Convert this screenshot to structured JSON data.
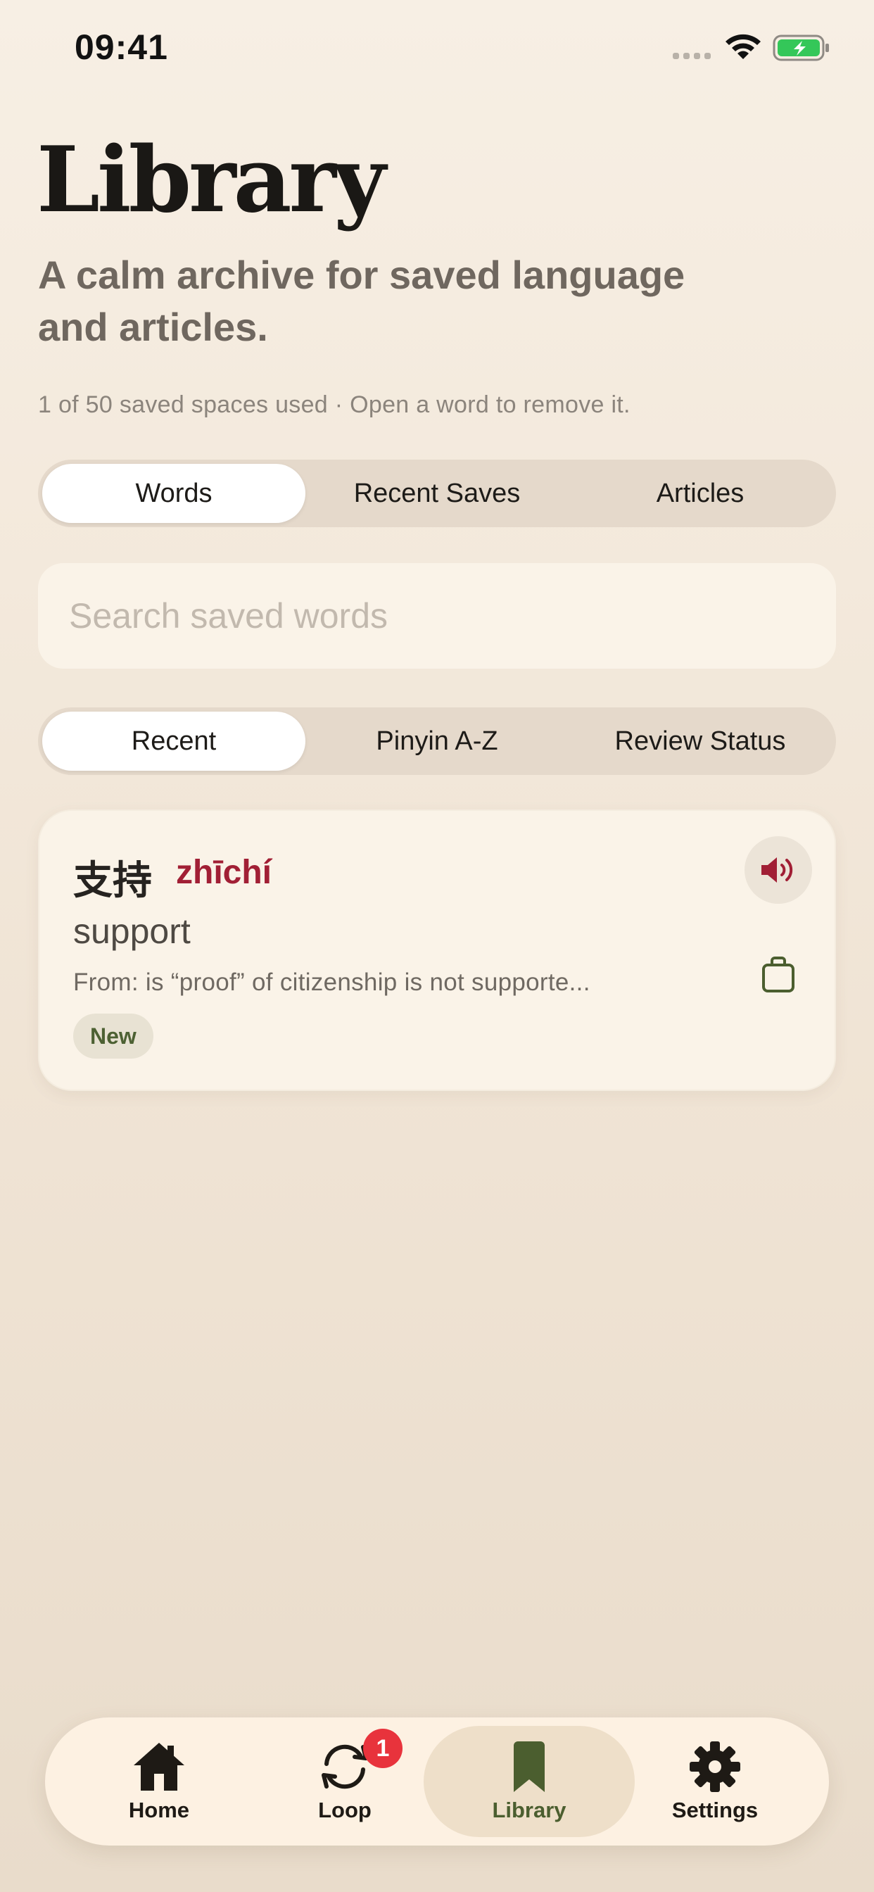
{
  "status_bar": {
    "time": "09:41"
  },
  "header": {
    "title": "Library",
    "subtitle": "A calm archive for saved language and articles.",
    "usage_note": "1 of 50 saved spaces used · Open a word to remove it."
  },
  "library_tabs": [
    {
      "label": "Words",
      "active": true
    },
    {
      "label": "Recent Saves",
      "active": false
    },
    {
      "label": "Articles",
      "active": false
    }
  ],
  "search": {
    "placeholder": "Search saved words"
  },
  "sort_options": [
    {
      "label": "Recent",
      "active": true
    },
    {
      "label": "Pinyin A-Z",
      "active": false
    },
    {
      "label": "Review Status",
      "active": false
    }
  ],
  "words": [
    {
      "hanzi": "支持",
      "pinyin": "zhīchí",
      "meaning": "support",
      "source": "From: is “proof” of citizenship is not supporte...",
      "badge": "New"
    }
  ],
  "tab_bar": {
    "items": [
      {
        "label": "Home",
        "icon": "house-icon",
        "active": false
      },
      {
        "label": "Loop",
        "icon": "loop-arrows-icon",
        "active": false,
        "badge": "1"
      },
      {
        "label": "Library",
        "icon": "bookmark-icon",
        "active": true
      },
      {
        "label": "Settings",
        "icon": "gear-icon",
        "active": false
      }
    ]
  },
  "colors": {
    "accent_red": "#a11f35",
    "accent_green": "#4b5e2f",
    "badge_red": "#e8333c",
    "battery_green": "#34c759"
  }
}
